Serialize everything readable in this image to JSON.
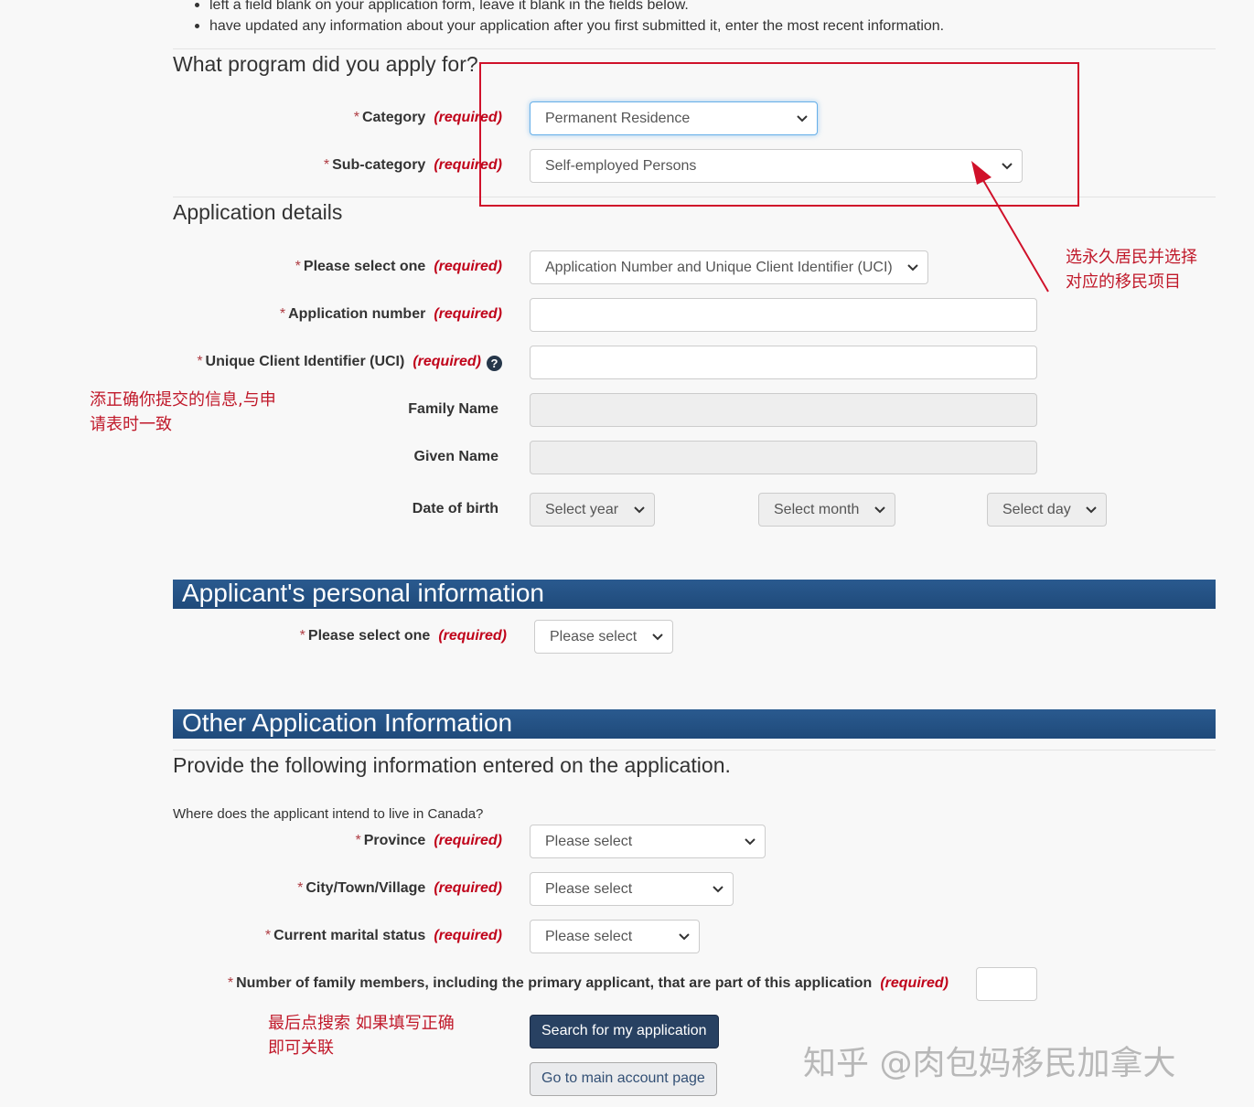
{
  "intro_bullets": [
    "left a field blank on your application form, leave it blank in the fields below.",
    "have updated any information about your application after you first submitted it, enter the most recent information."
  ],
  "program": {
    "heading": "What program did you apply for?",
    "category": {
      "label": "Category",
      "value": "Permanent Residence"
    },
    "subcategory": {
      "label": "Sub-category",
      "value": "Self-employed Persons"
    }
  },
  "required_text": "(required)",
  "required_star": "*",
  "details": {
    "heading": "Application details",
    "select_one": {
      "label": "Please select one",
      "value": "Application Number and Unique Client Identifier (UCI)"
    },
    "app_number": {
      "label": "Application number",
      "value": ""
    },
    "uci": {
      "label": "Unique Client Identifier (UCI)",
      "value": ""
    },
    "family_name": {
      "label": "Family Name"
    },
    "given_name": {
      "label": "Given Name"
    },
    "dob": {
      "label": "Date of birth",
      "year": "Select year",
      "month": "Select month",
      "day": "Select day"
    }
  },
  "personal": {
    "banner": "Applicant's personal information",
    "select_one": {
      "label": "Please select one",
      "value": "Please select"
    }
  },
  "other": {
    "banner": "Other Application Information",
    "subheading": "Provide the following information entered on the application.",
    "live_question": "Where does the applicant intend to live in Canada?",
    "province": {
      "label": "Province",
      "value": "Please select"
    },
    "city": {
      "label": "City/Town/Village",
      "value": "Please select"
    },
    "marital": {
      "label": "Current marital status",
      "value": "Please select"
    },
    "family_members": {
      "label": "Number of family members, including the primary applicant, that are part of this application",
      "value": ""
    }
  },
  "buttons": {
    "search": "Search for my application",
    "main_account": "Go to main account page"
  },
  "annotations": {
    "note1_line1": "选永久居民并选择",
    "note1_line2": "对应的移民项目",
    "note2_line1": "添正确你提交的信息,与申",
    "note2_line2": "请表时一致",
    "note3_line1": "最后点搜索 如果填写正确",
    "note3_line2": "即可关联",
    "color": "#c0192a"
  },
  "watermark": "知乎 @肉包妈移民加拿大",
  "icons": {
    "help": "question-circle-icon",
    "chevron": "chevron-down-icon"
  },
  "colors": {
    "banner": "#1f4a7a",
    "required": "#c0031a",
    "primary_button": "#284162"
  }
}
